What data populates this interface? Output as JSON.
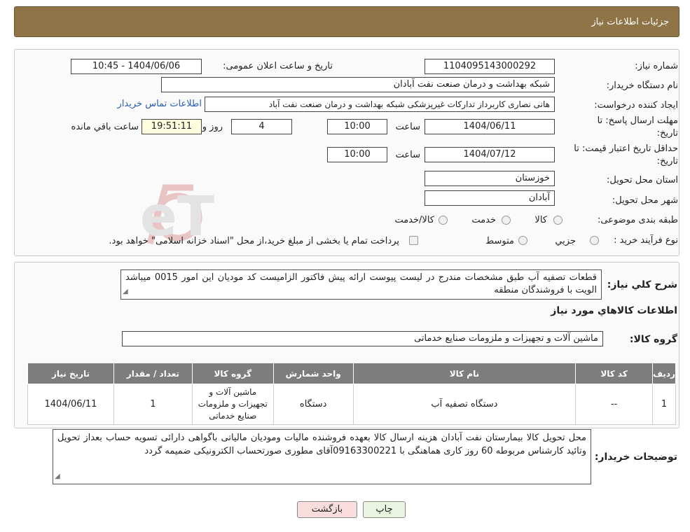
{
  "header": {
    "title": "جزئیات اطلاعات نیاز"
  },
  "info": {
    "need_number_label": "شماره نیاز:",
    "need_number": "1104095143000292",
    "announce_label": "تاریخ و ساعت اعلان عمومی:",
    "announce_value": "1404/06/06 - 10:45",
    "buyer_org_label": "نام دستگاه خریدار:",
    "buyer_org": "شبکه بهداشت و درمان صنعت نفت آبادان",
    "requester_label": "ایجاد کننده درخواست:",
    "requester": "هانی نصاری کاربرداز تدارکات غیرپزشکی شبکه بهداشت و درمان صنعت نفت آباد",
    "contact_link": "اطلاعات تماس خریدار",
    "deadline_label_1": "مهلت ارسال پاسخ: تا",
    "deadline_label_2": "تاریخ:",
    "deadline_date": "1404/06/11",
    "time_label": "ساعت",
    "deadline_time": "10:00",
    "days_value": "4",
    "days_label": "روز و",
    "remaining_time": "19:51:11",
    "remaining_label": "ساعت باقي مانده",
    "validity_label_1": "حداقل تاریخ اعتبار قیمت: تا",
    "validity_label_2": "تاریخ:",
    "validity_date": "1404/07/12",
    "validity_time_label": "ساعت",
    "validity_time": "10:00",
    "province_label": "استان محل تحویل:",
    "province": "خوزستان",
    "city_label": "شهر محل تحویل:",
    "city": "آبادان",
    "category_label": "طبقه بندی موضوعی:",
    "category_options": [
      "کالا",
      "خدمت",
      "کالا/خدمت"
    ],
    "process_label": "نوع فرآیند خرید :",
    "process_options": [
      "جزیي",
      "متوسط"
    ],
    "process_note": "پرداخت تمام یا بخشی از مبلغ خرید،از محل \"اسناد خزانه اسلامی\" خواهد بود."
  },
  "summary": {
    "label": "شرح کلي نیاز:",
    "text": "قطعات تصفیه آب طبق مشخصات مندرج در لیست پیوست ارائه پیش فاکتور الزامیست کد مودیان این امور 0015 میباشد الویت با فروشندگان منطقه"
  },
  "goods": {
    "section_title": "اطلاعات کالاهاي مورد نیاز",
    "group_label": "گروه کالا:",
    "group_value": "ماشین آلات و تجهیزات و ملزومات صنایع خدماتی",
    "table": {
      "headers": [
        "ردیف",
        "کد کالا",
        "نام کالا",
        "واحد شمارش",
        "گروه کالا",
        "تعداد / مقدار",
        "تاریخ نیاز"
      ],
      "rows": [
        [
          "1",
          "--",
          "دستگاه تصفیه آب",
          "دستگاه",
          "ماشین آلات و تجهیزات و ملزومات صنایع خدماتی",
          "1",
          "1404/06/11"
        ]
      ]
    }
  },
  "buyer_notes": {
    "label": "توضیحات خریدار:",
    "text": "محل تحویل کالا بیمارستان نفت آبادان هزینه ارسال کالا بعهده فروشنده مالیات ومودیان مالیاتی باگواهی دارائی تسویه حساب بعداز تحویل وتائید کارشناس مربوطه 60 روز کاری هماهنگی با 09163300221آقای مطوری صورتحساب الکترونیکی ضمیمه گردد"
  },
  "buttons": {
    "print": "چاپ",
    "back": "بازگشت"
  },
  "watermark": {
    "text": "AriaTender.neT"
  },
  "colors": {
    "header_bg": "#8f7447",
    "table_header": "#7d7d7d",
    "print_btn": "#e9f5e1",
    "back_btn": "#f9dcdc"
  }
}
